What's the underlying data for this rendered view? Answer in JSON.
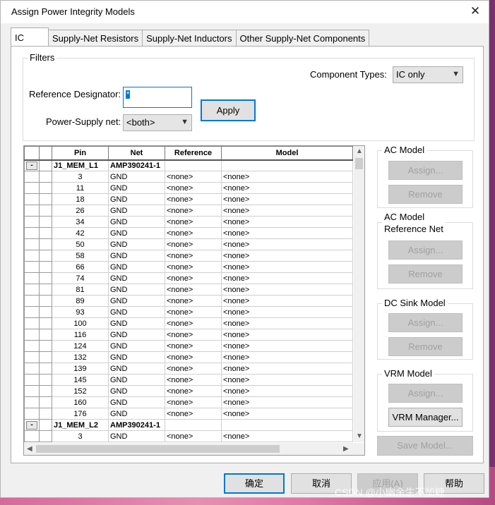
{
  "window": {
    "title": "Assign Power Integrity Models",
    "close_glyph": "✕"
  },
  "tabs": [
    "IC",
    "Supply-Net Resistors",
    "Supply-Net Inductors",
    "Other Supply-Net Components"
  ],
  "filters": {
    "legend": "Filters",
    "component_types_label": "Component Types:",
    "component_types_value": "IC only",
    "refdes_label": "Reference Designator:",
    "refdes_value": "*",
    "power_net_label": "Power-Supply net:",
    "power_net_value": "<both>",
    "apply": "Apply"
  },
  "grid": {
    "columns": [
      "",
      "",
      "Pin",
      "Net",
      "Reference",
      "Model"
    ],
    "rows": [
      {
        "group": true,
        "expander": "-",
        "pin": "J1_MEM_L1",
        "net": "AMP390241-1",
        "ref": "",
        "model": ""
      },
      {
        "pin": "3",
        "net": "GND",
        "ref": "<none>",
        "model": "<none>"
      },
      {
        "pin": "11",
        "net": "GND",
        "ref": "<none>",
        "model": "<none>"
      },
      {
        "pin": "18",
        "net": "GND",
        "ref": "<none>",
        "model": "<none>"
      },
      {
        "pin": "26",
        "net": "GND",
        "ref": "<none>",
        "model": "<none>"
      },
      {
        "pin": "34",
        "net": "GND",
        "ref": "<none>",
        "model": "<none>"
      },
      {
        "pin": "42",
        "net": "GND",
        "ref": "<none>",
        "model": "<none>"
      },
      {
        "pin": "50",
        "net": "GND",
        "ref": "<none>",
        "model": "<none>"
      },
      {
        "pin": "58",
        "net": "GND",
        "ref": "<none>",
        "model": "<none>"
      },
      {
        "pin": "66",
        "net": "GND",
        "ref": "<none>",
        "model": "<none>"
      },
      {
        "pin": "74",
        "net": "GND",
        "ref": "<none>",
        "model": "<none>"
      },
      {
        "pin": "81",
        "net": "GND",
        "ref": "<none>",
        "model": "<none>"
      },
      {
        "pin": "89",
        "net": "GND",
        "ref": "<none>",
        "model": "<none>"
      },
      {
        "pin": "93",
        "net": "GND",
        "ref": "<none>",
        "model": "<none>"
      },
      {
        "pin": "100",
        "net": "GND",
        "ref": "<none>",
        "model": "<none>"
      },
      {
        "pin": "116",
        "net": "GND",
        "ref": "<none>",
        "model": "<none>"
      },
      {
        "pin": "124",
        "net": "GND",
        "ref": "<none>",
        "model": "<none>"
      },
      {
        "pin": "132",
        "net": "GND",
        "ref": "<none>",
        "model": "<none>"
      },
      {
        "pin": "139",
        "net": "GND",
        "ref": "<none>",
        "model": "<none>"
      },
      {
        "pin": "145",
        "net": "GND",
        "ref": "<none>",
        "model": "<none>"
      },
      {
        "pin": "152",
        "net": "GND",
        "ref": "<none>",
        "model": "<none>"
      },
      {
        "pin": "160",
        "net": "GND",
        "ref": "<none>",
        "model": "<none>"
      },
      {
        "pin": "176",
        "net": "GND",
        "ref": "<none>",
        "model": "<none>"
      },
      {
        "group": true,
        "expander": "-",
        "pin": "J1_MEM_L2",
        "net": "AMP390241-1",
        "ref": "",
        "model": ""
      },
      {
        "pin": "3",
        "net": "GND",
        "ref": "<none>",
        "model": "<none>"
      }
    ]
  },
  "side": {
    "ac_model": {
      "legend": "AC Model",
      "assign": "Assign...",
      "remove": "Remove"
    },
    "ac_ref_net": {
      "legend_line1": "AC Model",
      "legend_line2": "Reference Net",
      "assign": "Assign...",
      "remove": "Remove"
    },
    "dc_sink": {
      "legend": "DC Sink Model",
      "assign": "Assign...",
      "remove": "Remove"
    },
    "vrm": {
      "legend": "VRM Model",
      "assign": "Assign...",
      "manager": "VRM Manager..."
    },
    "save_model": "Save Model..."
  },
  "footer": {
    "ok": "确定",
    "cancel": "取消",
    "apply": "应用(A)",
    "help": "帮助"
  },
  "watermark": "CSDN @小幽余生不加糖"
}
